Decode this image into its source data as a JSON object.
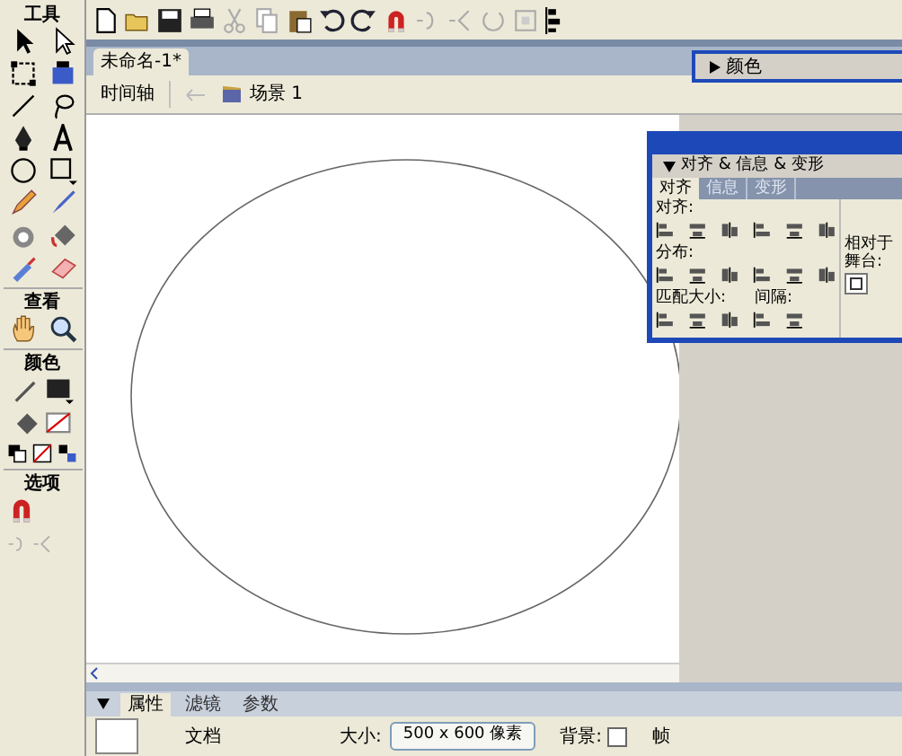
{
  "toolbox": {
    "sections": [
      {
        "title": "工具"
      },
      {
        "title": "查看"
      },
      {
        "title": "颜色"
      },
      {
        "title": "选项"
      }
    ]
  },
  "document": {
    "tab": "未命名-1*",
    "timeline_button": "时间轴",
    "scene": "场景 1"
  },
  "color_panel": {
    "title": "颜色",
    "expanded": false
  },
  "align_panel": {
    "title": "对齐 & 信息 & 变形",
    "expanded": true,
    "tabs": [
      {
        "label": "对齐",
        "selected": true
      },
      {
        "label": "信息",
        "selected": false
      },
      {
        "label": "变形",
        "selected": false
      }
    ],
    "align_label": "对齐:",
    "distribute_label": "分布:",
    "match_size_label": "匹配大小:",
    "spacing_label": "间隔:",
    "relative_label": "相对于舞台:"
  },
  "properties": {
    "expanded": true,
    "tabs": [
      {
        "label": "属性",
        "selected": true
      },
      {
        "label": "滤镜",
        "selected": false
      },
      {
        "label": "参数",
        "selected": false
      }
    ],
    "doc_label": "文档",
    "size_label": "大小:",
    "size_button": "500 x 600 像素",
    "background_label": "背景:",
    "frame_rate_label": "帧"
  }
}
